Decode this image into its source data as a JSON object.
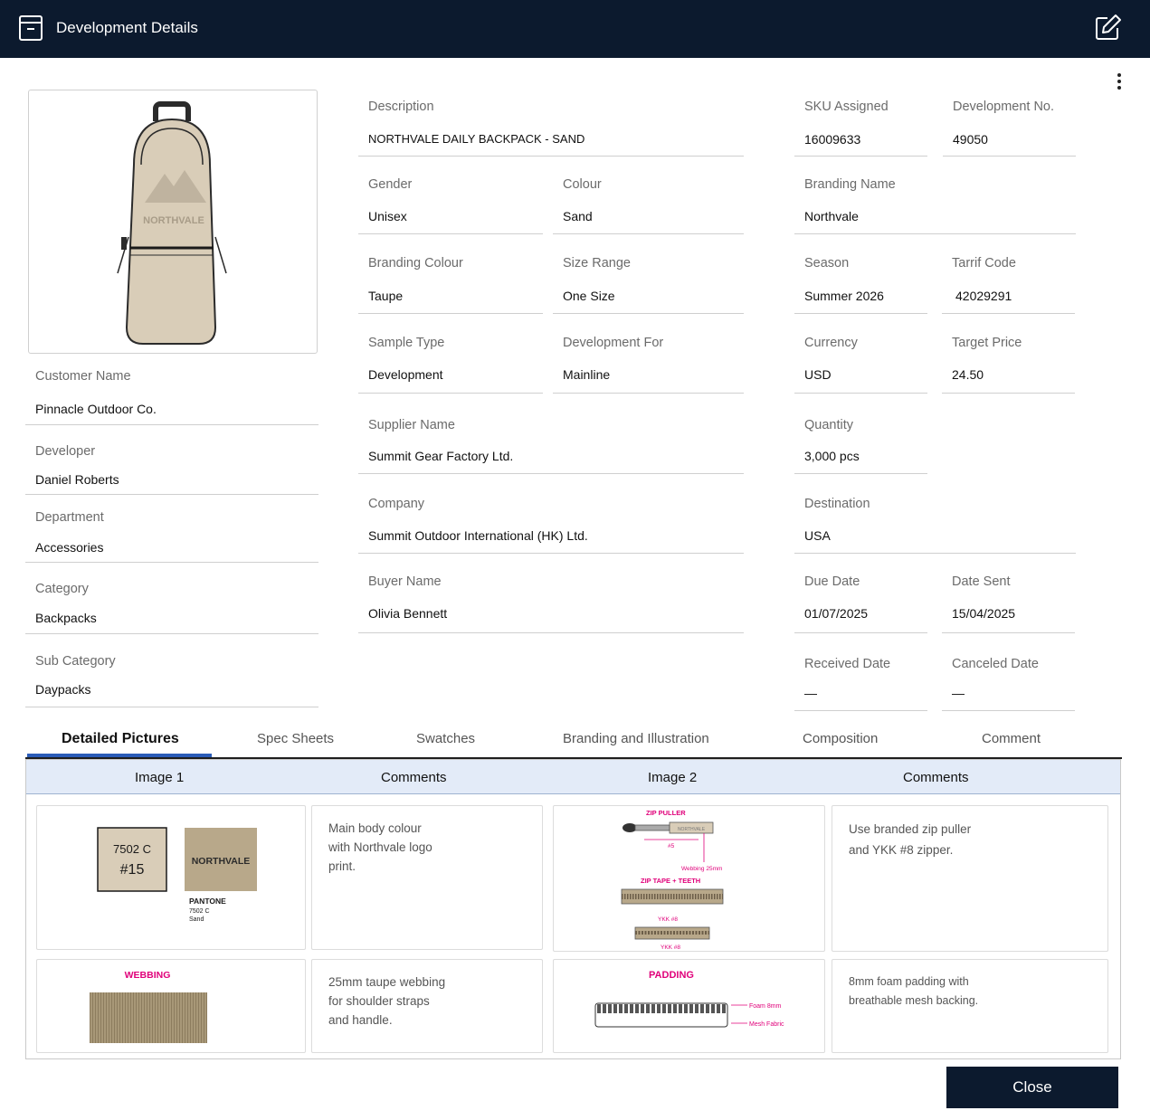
{
  "header": {
    "title": "Development Details",
    "title_icon": "archive-box-icon",
    "edit_icon": "edit-icon"
  },
  "menu_icon": "more-vertical-icon",
  "product_image": {
    "brand_text": "NORTHVALE"
  },
  "left_fields": [
    {
      "label": "Customer Name",
      "value": "Pinnacle Outdoor Co."
    },
    {
      "label": "Developer",
      "value": "Daniel Roberts"
    },
    {
      "label": "Department",
      "value": "Accessories"
    },
    {
      "label": "Category",
      "value": "Backpacks"
    },
    {
      "label": "Sub Category",
      "value": "Daypacks"
    }
  ],
  "details": {
    "description": {
      "label": "Description",
      "value": "NORTHVALE DAILY BACKPACK - SAND"
    },
    "sku_assigned": {
      "label": "SKU Assigned",
      "value": "16009633"
    },
    "development_no": {
      "label": "Development No.",
      "value": "49050"
    },
    "gender": {
      "label": "Gender",
      "value": "Unisex"
    },
    "colour": {
      "label": "Colour",
      "value": "Sand"
    },
    "branding_name": {
      "label": "Branding Name",
      "value": "Northvale"
    },
    "branding_colour": {
      "label": "Branding Colour",
      "value": "Taupe"
    },
    "size_range": {
      "label": "Size Range",
      "value": "One Size"
    },
    "season": {
      "label": "Season",
      "value": "Summer 2026"
    },
    "tarrif_code": {
      "label": "Tarrif Code",
      "value": "42029291"
    },
    "sample_type": {
      "label": "Sample Type",
      "value": "Development"
    },
    "development_for": {
      "label": "Development For",
      "value": "Mainline"
    },
    "currency": {
      "label": "Currency",
      "value": "USD"
    },
    "target_price": {
      "label": "Target Price",
      "value": "24.50"
    },
    "supplier_name": {
      "label": "Supplier Name",
      "value": "Summit Gear Factory Ltd."
    },
    "quantity": {
      "label": "Quantity",
      "value": "3,000 pcs"
    },
    "company": {
      "label": "Company",
      "value": "Summit Outdoor International (HK) Ltd."
    },
    "destination": {
      "label": "Destination",
      "value": "USA"
    },
    "buyer_name": {
      "label": "Buyer Name",
      "value": "Olivia Bennett"
    },
    "due_date": {
      "label": "Due Date",
      "value": "01/07/2025"
    },
    "date_sent": {
      "label": "Date Sent",
      "value": "15/04/2025"
    },
    "received_date": {
      "label": "Received Date",
      "value": "—"
    },
    "canceled_date": {
      "label": "Canceled Date",
      "value": "—"
    }
  },
  "tabs": [
    "Detailed Pictures",
    "Spec Sheets",
    "Swatches",
    "Branding and Illustration",
    "Composition",
    "Comment"
  ],
  "active_tab": "Detailed Pictures",
  "grid": {
    "headers": [
      "Image 1",
      "Comments",
      "Image 2",
      "Comments"
    ],
    "row1": {
      "image1": {
        "swatch_code": "7502 C",
        "swatch_number": "#15",
        "brand": "NORTHVALE",
        "pantone": "PANTONE",
        "pantone_code": "7502 C",
        "pantone_name": "Sand"
      },
      "comment1": "Main body colour\nwith Northvale logo\nprint.",
      "image2": {
        "zip_title": "ZIP PULLER",
        "zip_label": "NORTHVALE",
        "zip_size": "#5",
        "webbing_note": "Webbing 25mm",
        "tape_title": "ZIP TAPE + TEETH",
        "ykk_top": "YKK #8",
        "ykk_bottom": "YKK #8"
      },
      "comment2": "Use branded zip puller\nand YKK #8 zipper."
    },
    "row2": {
      "image1": {
        "title": "WEBBING"
      },
      "comment1": "25mm taupe webbing\nfor shoulder straps\nand handle.",
      "image2": {
        "title": "PADDING",
        "foam_label": "Foam 8mm",
        "mesh_label": "Mesh Fabric"
      },
      "comment2": "8mm foam padding with\nbreathable mesh backing."
    }
  },
  "close_label": "Close",
  "colors": {
    "header_bg": "#0c1a2e",
    "accent": "#2a5cb8",
    "grid_head_bg": "#e3ebf8",
    "magenta": "#e0007a",
    "sand": "#d9cdb8",
    "taupe": "#b8a88a"
  }
}
